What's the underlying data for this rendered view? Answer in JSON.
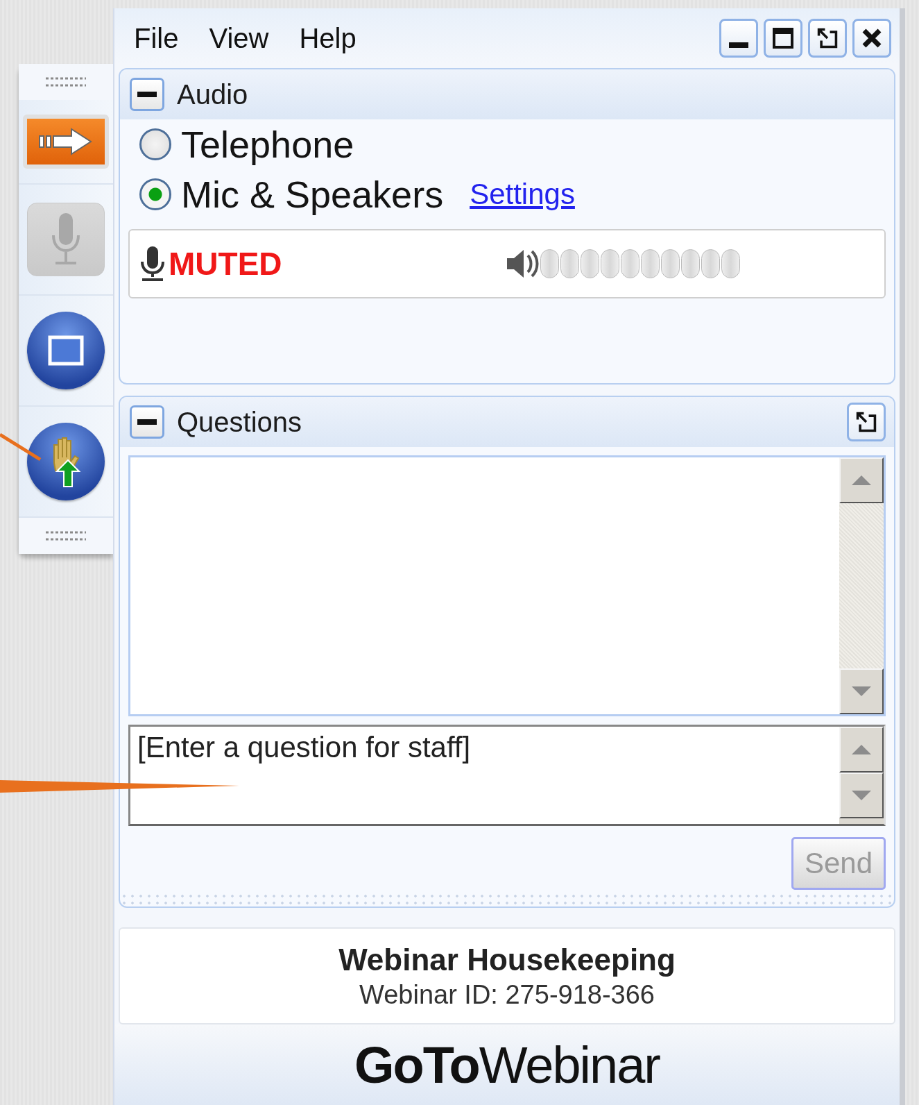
{
  "toolbar": {
    "buttons": [
      {
        "kind": "toggle-panel",
        "disabled": false
      },
      {
        "kind": "microphone",
        "disabled": true
      },
      {
        "kind": "screen",
        "disabled": false
      },
      {
        "kind": "raise-hand",
        "disabled": false
      }
    ]
  },
  "menu": [
    "File",
    "View",
    "Help"
  ],
  "window_controls": [
    {
      "kind": "minimize"
    },
    {
      "kind": "maximize"
    },
    {
      "kind": "pop-out"
    },
    {
      "kind": "close"
    }
  ],
  "audio": {
    "title": "Audio",
    "options": [
      {
        "label": "Telephone",
        "selected": false
      },
      {
        "label": "Mic & Speakers",
        "selected": true
      }
    ],
    "settings_link": "Settings",
    "mic_status": "MUTED"
  },
  "questions": {
    "title": "Questions",
    "input": {
      "placeholder": "[Enter a question for staff]"
    },
    "send_button": {
      "label": "Send",
      "disabled": true
    }
  },
  "webinar": {
    "title": "Webinar Housekeeping",
    "id": "Webinar ID: 275-918-366"
  },
  "logo": "**GoTo**Webinar"
}
